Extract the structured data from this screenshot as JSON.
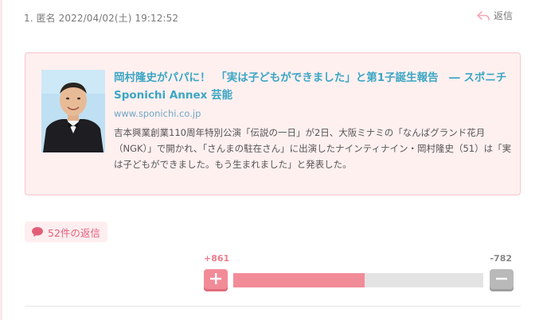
{
  "comment": {
    "header": "1. 匿名 2022/04/02(土) 19:12:52",
    "reply_label": "返信",
    "reply_icon": "reply-arrow-icon"
  },
  "link_card": {
    "title": "岡村隆史がパパに！　「実は子どもができました」と第1子誕生報告　― スポニチ Sponichi Annex 芸能",
    "domain": "www.sponichi.co.jp",
    "description": "吉本興業創業110周年特別公演「伝説の一日」が2日、大阪ミナミの「なんばグランド花月（NGK）」で開かれ、「さんまの駐在さん」に出演したナインティナイン・岡村隆史（51）は「実は子どもができました。もう生まれました」と発表した。",
    "thumbnail_icon": "article-thumbnail-photo"
  },
  "replies": {
    "label": "52件の返信",
    "icon": "speech-bubble-icon"
  },
  "votes": {
    "plus": "+861",
    "minus": "-782",
    "plus_fraction": 0.524
  },
  "colors": {
    "accent_pink": "#f28b98",
    "link_blue": "#3aa6c4",
    "card_bg": "#fff0f0",
    "badge_text": "#e25e77"
  }
}
